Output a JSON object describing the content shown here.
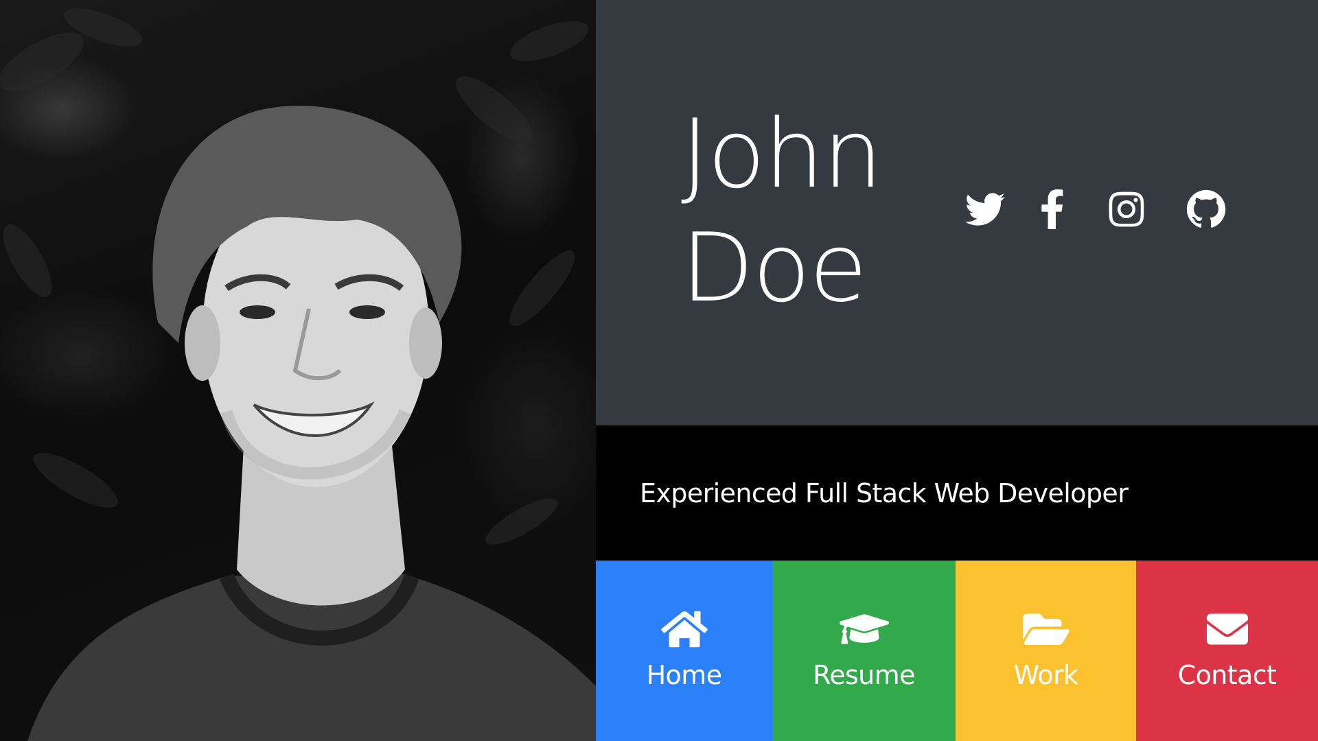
{
  "profile": {
    "first_name": "John",
    "last_name": "Doe",
    "tagline": "Experienced Full Stack Web Developer",
    "photo": "portrait-photo"
  },
  "social": [
    {
      "name": "twitter",
      "icon": "twitter-icon"
    },
    {
      "name": "facebook",
      "icon": "facebook-icon"
    },
    {
      "name": "instagram",
      "icon": "instagram-icon"
    },
    {
      "name": "github",
      "icon": "github-icon"
    }
  ],
  "nav": {
    "home": {
      "label": "Home",
      "icon": "home-icon",
      "color": "#2b7ff9"
    },
    "resume": {
      "label": "Resume",
      "icon": "graduation-cap-icon",
      "color": "#32a94a"
    },
    "work": {
      "label": "Work",
      "icon": "folder-open-icon",
      "color": "#fbc12e"
    },
    "contact": {
      "label": "Contact",
      "icon": "envelope-icon",
      "color": "#dc3446"
    }
  },
  "colors": {
    "header_bg": "#343a40",
    "tagline_bg": "#000000",
    "text": "#ffffff"
  }
}
